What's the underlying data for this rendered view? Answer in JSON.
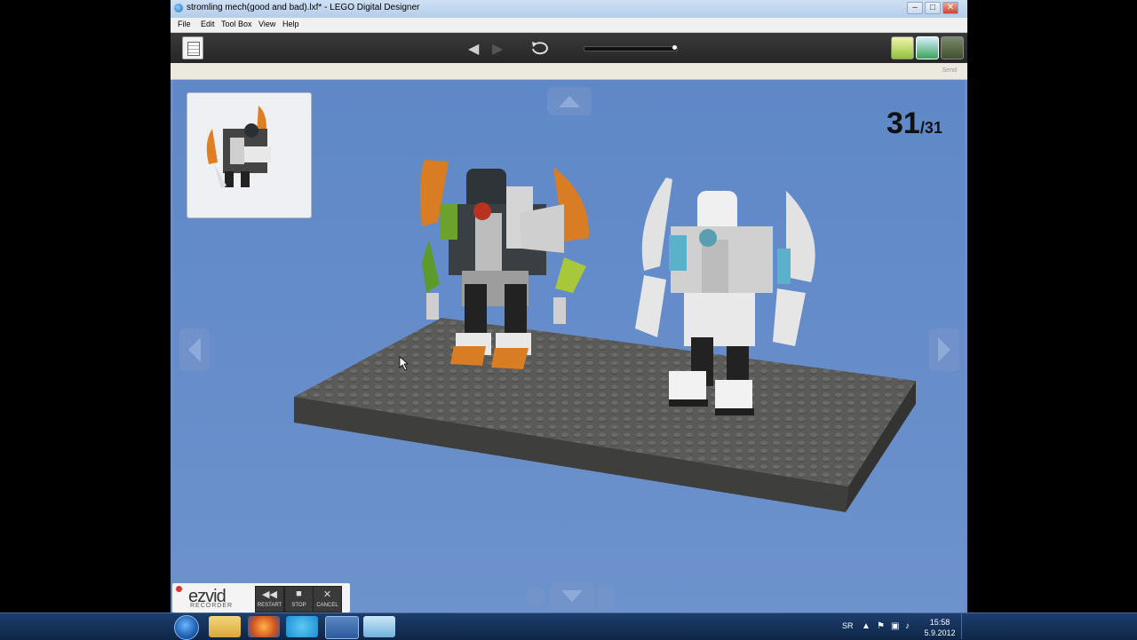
{
  "window": {
    "title": "stromling mech(good and bad).lxf* - LEGO Digital Designer",
    "minimize": "–",
    "maximize": "□",
    "close": "✕"
  },
  "menu": [
    "File",
    "Edit",
    "Tool Box",
    "View",
    "Help"
  ],
  "toolbar": {
    "back_icon": "triangle-left-icon",
    "forward_icon": "triangle-right-icon",
    "replay_icon": "rotate-arrow-icon",
    "progress_fraction": 1.0,
    "mode_buttons": [
      "build-mode-icon",
      "view-mode-icon",
      "building-guide-mode-icon"
    ]
  },
  "statusbar": {
    "send_label": "Send"
  },
  "viewport": {
    "step_current": "31",
    "step_total": "/31",
    "background_color": "#6b8fc9"
  },
  "ezvid": {
    "logo": "ezvid",
    "subtitle": "RECORDER",
    "buttons": [
      {
        "label": "RESTART",
        "symbol": "◀◀"
      },
      {
        "label": "STOP",
        "symbol": "■"
      },
      {
        "label": "CANCEL",
        "symbol": "✕"
      }
    ]
  },
  "taskbar": {
    "language": "SR",
    "time": "15:58",
    "date": "5.9.2012",
    "apps": [
      "file-explorer-icon",
      "firefox-icon",
      "skype-icon",
      "lego-designer-icon",
      "notes-icon"
    ]
  }
}
